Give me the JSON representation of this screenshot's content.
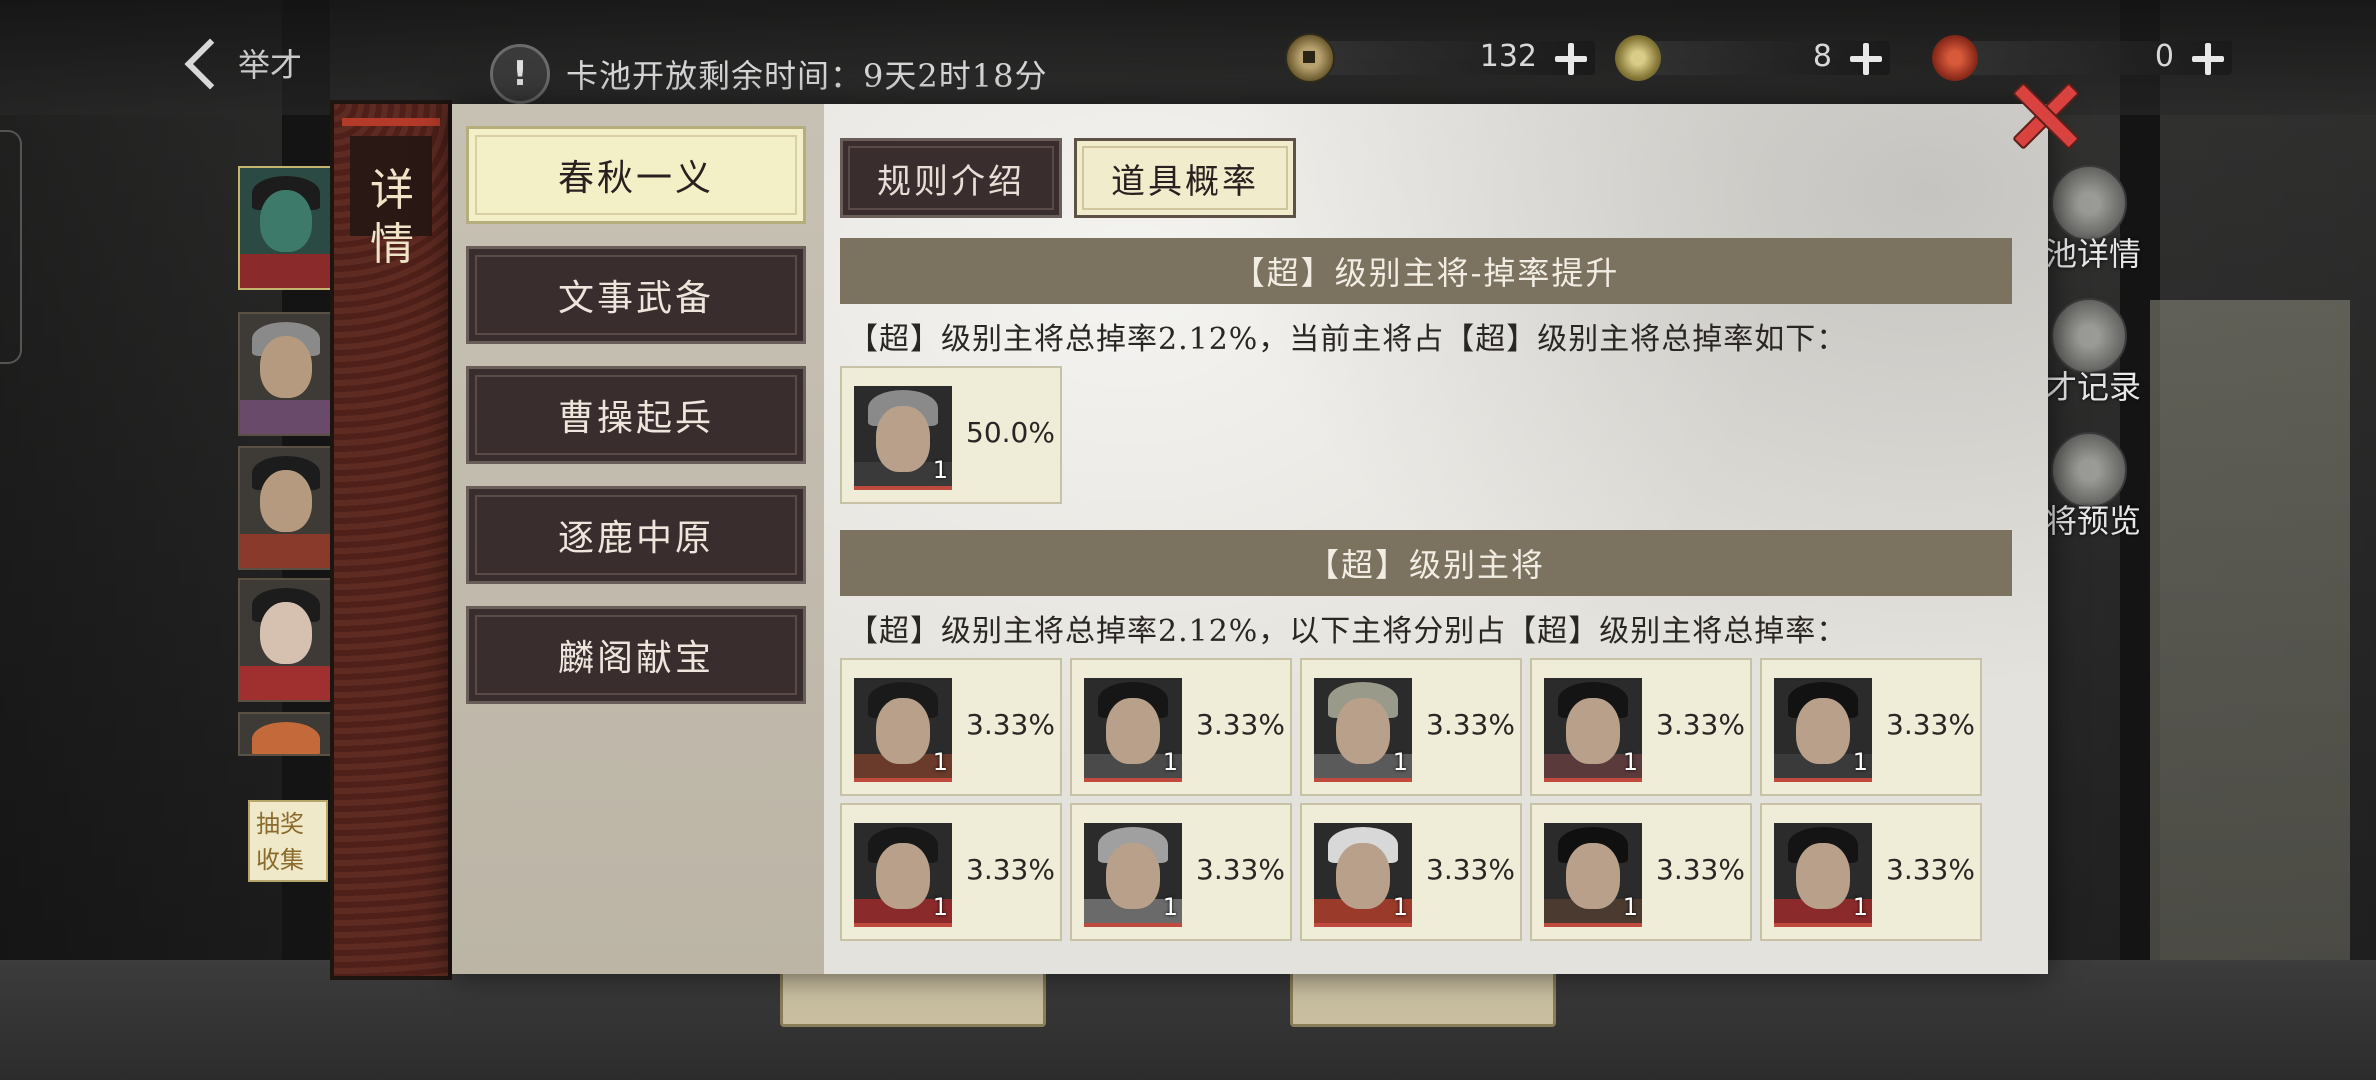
{
  "topbar": {
    "back_label": "举才",
    "notice_icon": "!",
    "notice_text": "卡池开放剩余时间：9天2时18分",
    "currencies": [
      {
        "icon": "coin-icon",
        "value": "132"
      },
      {
        "icon": "jade-icon",
        "value": "8"
      },
      {
        "icon": "seal-icon",
        "value": "0"
      }
    ]
  },
  "left_strip": {
    "tag": "抽奖收集"
  },
  "side_menu": [
    {
      "icon": "magnifier-icon",
      "label": "池详情"
    },
    {
      "icon": "brush-icon",
      "label": "才记录"
    },
    {
      "icon": "general-preview-icon",
      "label": "将预览"
    }
  ],
  "modal": {
    "vertical_tab": "详情",
    "categories": [
      {
        "label": "春秋一义",
        "active": true
      },
      {
        "label": "文事武备",
        "active": false
      },
      {
        "label": "曹操起兵",
        "active": false
      },
      {
        "label": "逐鹿中原",
        "active": false
      },
      {
        "label": "麟阁献宝",
        "active": false
      }
    ],
    "tabs": [
      {
        "label": "规则介绍",
        "active": false
      },
      {
        "label": "道具概率",
        "active": true
      }
    ],
    "sections": [
      {
        "title": "【超】级别主将-掉率提升",
        "desc": "【超】级别主将总掉率2.12%，当前主将占【超】级别主将总掉率如下：",
        "cards": [
          {
            "count": "1",
            "rate": "50.0%",
            "armor": "#3a3a3a",
            "hair": "#8a8a8a"
          }
        ]
      },
      {
        "title": "【超】级别主将",
        "desc": "【超】级别主将总掉率2.12%，以下主将分别占【超】级别主将总掉率：",
        "cards": [
          {
            "count": "1",
            "rate": "3.33%",
            "armor": "#6a3a2a",
            "hair": "#1a1a1a"
          },
          {
            "count": "1",
            "rate": "3.33%",
            "armor": "#4a4a4a",
            "hair": "#161616"
          },
          {
            "count": "1",
            "rate": "3.33%",
            "armor": "#5a5a5a",
            "hair": "#9a9a8a"
          },
          {
            "count": "1",
            "rate": "3.33%",
            "armor": "#5a3a3a",
            "hair": "#141414"
          },
          {
            "count": "1",
            "rate": "3.33%",
            "armor": "#3a3a3a",
            "hair": "#121212"
          },
          {
            "count": "1",
            "rate": "3.33%",
            "armor": "#8a2a2a",
            "hair": "#181818"
          },
          {
            "count": "1",
            "rate": "3.33%",
            "armor": "#6a6a6a",
            "hair": "#a0a0a0"
          },
          {
            "count": "1",
            "rate": "3.33%",
            "armor": "#9a3a2a",
            "hair": "#d8d8d8"
          },
          {
            "count": "1",
            "rate": "3.33%",
            "armor": "#4a3a30",
            "hair": "#101010"
          },
          {
            "count": "1",
            "rate": "3.33%",
            "armor": "#8a2a2a",
            "hair": "#141414"
          }
        ]
      }
    ]
  }
}
